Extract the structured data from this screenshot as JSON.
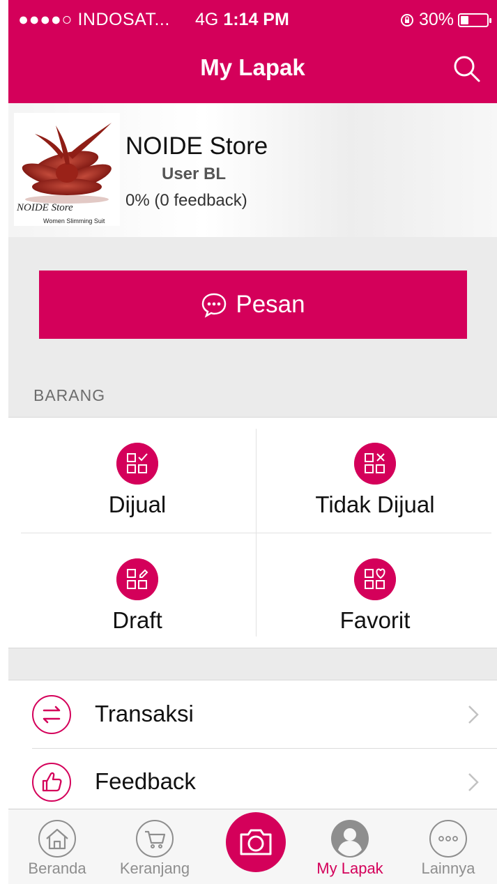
{
  "status_bar": {
    "carrier": "●●●●○ INDOSAT...",
    "network": "4G",
    "time": "1:14 PM",
    "battery": "30%",
    "battery_level": 0.3
  },
  "header": {
    "title": "My Lapak",
    "search_icon": "search-icon"
  },
  "profile": {
    "store_name": "NOIDE Store",
    "user_type": "User BL",
    "feedback": "0% (0 feedback)",
    "logo_text": "NOIDE Store",
    "logo_tagline": "Women Slimming Suit"
  },
  "actions": {
    "pesan_label": "Pesan",
    "pesan_icon": "chat-bubble-icon"
  },
  "section": {
    "barang_label": "BARANG"
  },
  "grid": [
    {
      "label": "Dijual",
      "icon": "grid-check-icon"
    },
    {
      "label": "Tidak Dijual",
      "icon": "grid-x-icon"
    },
    {
      "label": "Draft",
      "icon": "grid-edit-icon"
    },
    {
      "label": "Favorit",
      "icon": "grid-heart-icon"
    }
  ],
  "menu": [
    {
      "label": "Transaksi",
      "icon": "swap-arrows-icon"
    },
    {
      "label": "Feedback",
      "icon": "thumbs-up-icon"
    }
  ],
  "tabbar": [
    {
      "label": "Beranda",
      "icon": "home-icon"
    },
    {
      "label": "Keranjang",
      "icon": "cart-icon"
    },
    {
      "label": "",
      "icon": "camera-icon"
    },
    {
      "label": "My Lapak",
      "icon": "user-icon"
    },
    {
      "label": "Lainnya",
      "icon": "more-dots-icon"
    }
  ],
  "colors": {
    "brand": "#d4005a",
    "background_gray": "#ebebeb",
    "tab_inactive": "#8e8e8e"
  }
}
